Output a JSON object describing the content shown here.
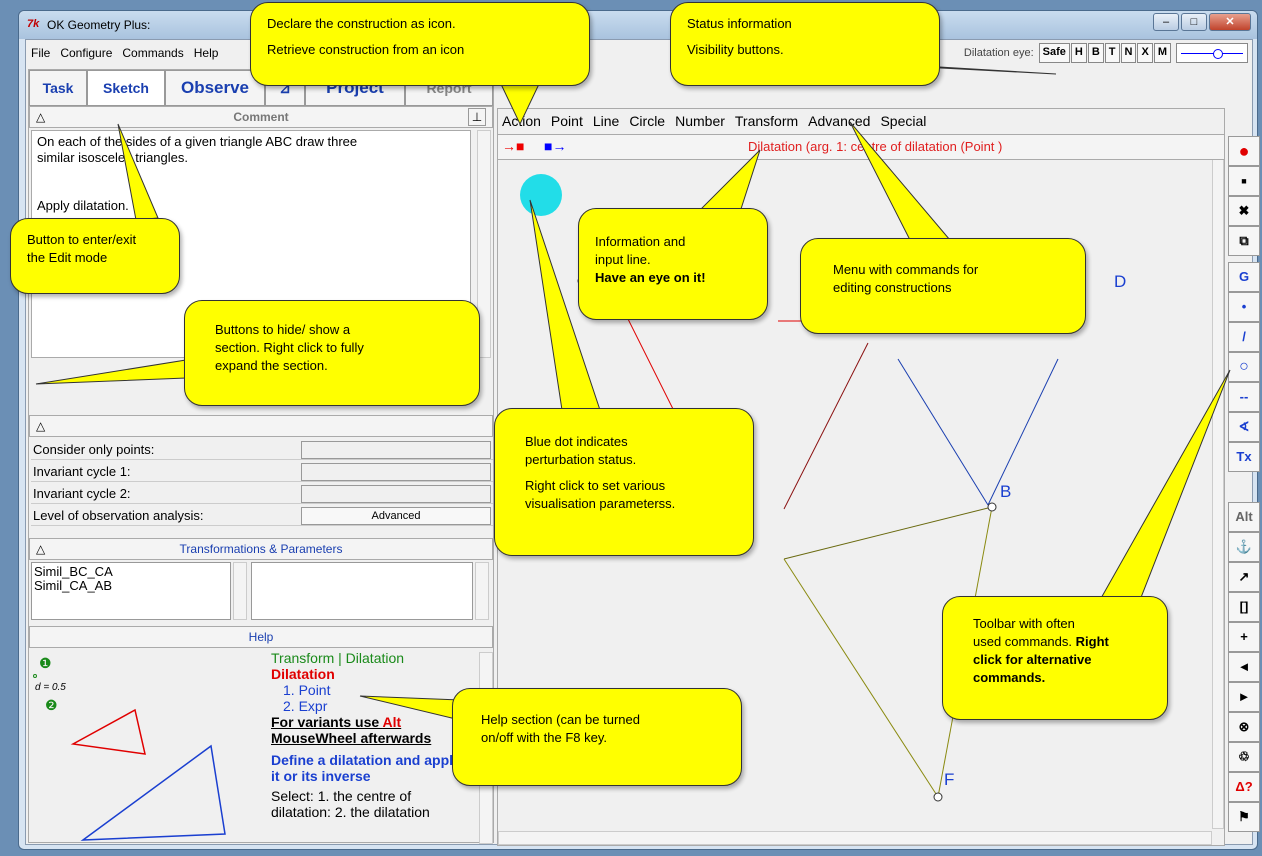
{
  "window": {
    "title": "OK Geometry Plus:",
    "logo": "7k"
  },
  "menubar": {
    "items": [
      "File",
      "Configure",
      "Commands",
      "Help"
    ]
  },
  "status": {
    "dilatation": "Dilatation",
    "eye": "eye:",
    "buttons": [
      "Safe",
      "H",
      "B",
      "T",
      "N",
      "X",
      "M"
    ]
  },
  "tabs": [
    "Task",
    "Sketch",
    "Observe",
    "⊿",
    "Project",
    "Report"
  ],
  "comment": {
    "header": "Comment",
    "text_lines": [
      "On each of the sides of a given triangle ABC draw three",
      "similar isosceles triangles.",
      "",
      "",
      "Apply dilatation."
    ]
  },
  "observe": {
    "rows": [
      {
        "label": "Consider only points:"
      },
      {
        "label": "Invariant cycle 1:"
      },
      {
        "label": "Invariant cycle 2:"
      },
      {
        "label": "Level of observation analysis:",
        "select": "Advanced"
      }
    ]
  },
  "transformations": {
    "header": "Transformations & Parameters",
    "items": [
      "Simil_BC_CA",
      "Simil_CA_AB"
    ]
  },
  "help": {
    "header": "Help",
    "breadcrumb": "Transform | Dilatation",
    "title": "Dilatation",
    "steps": [
      "1.  Point",
      "2.  Expr"
    ],
    "variants_a": "For variants use ",
    "variants_alt": "Alt",
    "variants_b": "MouseWheel afterwards",
    "define": "Define a dilatation and apply it or its inverse",
    "select": "Select: 1. the centre of dilatation: 2. the dilatation",
    "diagram_label": "d = 0.5",
    "marker1": "❶",
    "marker2": "❷"
  },
  "canvas_menu": [
    "Action",
    "Point",
    "Line",
    "Circle",
    "Number",
    "Transform",
    "Advanced",
    "Special"
  ],
  "infoline": {
    "left_arrows": "→■",
    "right_arrows": "■→",
    "text": "Dilatation (arg. 1:  centre of dilatation (Point )"
  },
  "points": {
    "B": "B",
    "D": "D",
    "F": "F"
  },
  "toolbar": [
    "●",
    "■",
    "✖",
    "⧉",
    "G",
    "•",
    "/",
    "○",
    "--",
    "∢",
    "Tx",
    "Alt",
    "⚓",
    "↗",
    "[]",
    "+",
    "◄",
    "►",
    "⊗",
    "♲",
    "Δ?",
    "⚑"
  ],
  "callouts": {
    "declare": [
      "Declare the construction as icon.",
      "Retrieve  construction from an icon"
    ],
    "status": [
      "Status information",
      "Visibility buttons."
    ],
    "edit": [
      "Button to enter/exit",
      "the Edit mode"
    ],
    "info": [
      "Information and",
      "input  line."
    ],
    "info_bold": "Have an eye on it!",
    "menu": [
      "Menu with commands for",
      "editing constructions"
    ],
    "sections": [
      "Buttons to hide/ show a",
      "section. Right click to fully",
      "expand the section."
    ],
    "bluedot": [
      "Blue dot indicates",
      "perturbation status."
    ],
    "bluedot2": [
      "Right click to set  various",
      "visualisation parameterss."
    ],
    "toolbar": [
      "Toolbar with often",
      "used commands."
    ],
    "toolbar_bold": [
      "Right",
      "click for alternative",
      "commands."
    ],
    "help": [
      "Help section (can be turned",
      "on/off with the F8 key."
    ]
  },
  "colors": {
    "accent": "#1a3fb0",
    "callout": "#ffff00",
    "red": "#e02020"
  }
}
